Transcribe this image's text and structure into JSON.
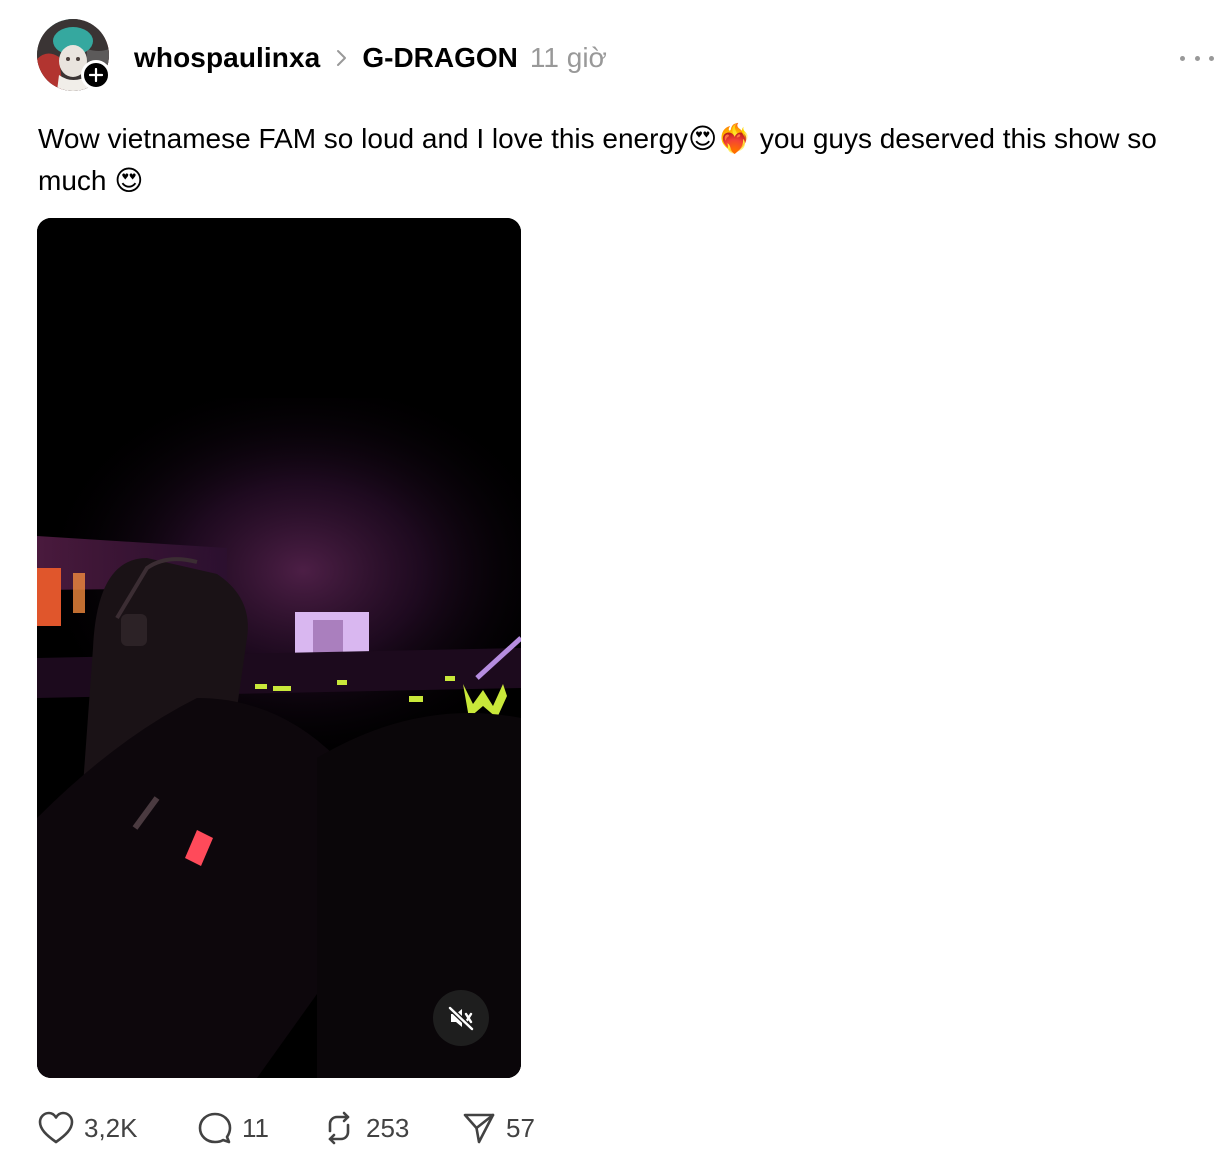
{
  "header": {
    "username": "whospaulinxa",
    "topic": "G-DRAGON",
    "time": "11 giờ"
  },
  "caption": {
    "line1_a": "Wow vietnamese FAM so loud and I love this energy",
    "emoji1": "😍",
    "emoji2": "❤️‍🔥",
    "line1_b": " you guys deserved this show so much ",
    "emoji3": "😍"
  },
  "actions": {
    "likes": "3,2K",
    "replies": "11",
    "reposts": "253",
    "shares": "57"
  },
  "icons": {
    "follow": "plus-icon",
    "separator": "chevron-right-icon",
    "more": "more-horizontal-icon",
    "mute": "speaker-muted-icon",
    "like": "heart-icon",
    "reply": "comment-bubble-icon",
    "repost": "repost-icon",
    "share": "send-icon"
  },
  "video": {
    "muted": true
  }
}
